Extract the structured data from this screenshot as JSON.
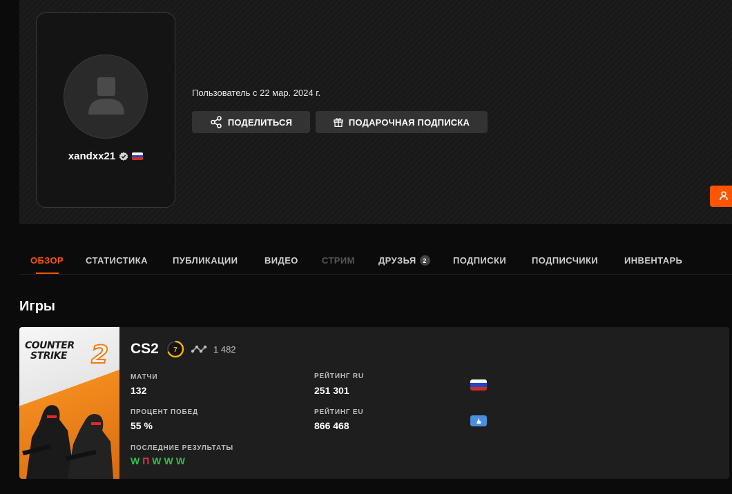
{
  "profile": {
    "username": "xandxx21",
    "member_since": "Пользователь с 22 мар. 2024 г.",
    "share_label": "ПОДЕЛИТЬСЯ",
    "gift_label": "ПОДАРОЧНАЯ ПОДПИСКА"
  },
  "nav": {
    "items": [
      {
        "label": "ОБЗОР",
        "state": "active"
      },
      {
        "label": "СТАТИСТИКА"
      },
      {
        "label": "ПУБЛИКАЦИИ"
      },
      {
        "label": "ВИДЕО"
      },
      {
        "label": "СТРИМ",
        "state": "disabled"
      },
      {
        "label": "ДРУЗЬЯ",
        "badge": "2"
      },
      {
        "label": "ПОДПИСКИ"
      },
      {
        "label": "ПОДПИСЧИКИ"
      },
      {
        "label": "ИНВЕНТАРЬ"
      }
    ]
  },
  "games": {
    "title": "Игры",
    "cover": {
      "line1": "COUNTER",
      "line2": "STRIKE",
      "digit": "2"
    },
    "cs2": {
      "name": "CS2",
      "level": "7",
      "elo": "1 482",
      "matches_label": "МАТЧИ",
      "matches": "132",
      "winrate_label": "ПРОЦЕНТ ПОБЕД",
      "winrate": "55 %",
      "recent_label": "ПОСЛЕДНИЕ РЕЗУЛЬТАТЫ",
      "recent": [
        "W",
        "П",
        "W",
        "W",
        "W"
      ],
      "rating_ru_label": "РЕЙТИНГ RU",
      "rating_ru": "251 301",
      "rating_eu_label": "РЕЙТИНГ EU",
      "rating_eu": "866 468"
    }
  },
  "colors": {
    "accent": "#ff5500",
    "win": "#2ec04a",
    "loss": "#e5333b",
    "level": "#f5b700"
  },
  "icons": [
    "user-silhouette-icon",
    "verified-icon",
    "russia-flag-icon",
    "share-icon",
    "gift-icon",
    "elo-graph-icon",
    "eu-region-icon",
    "add-friend-icon"
  ]
}
